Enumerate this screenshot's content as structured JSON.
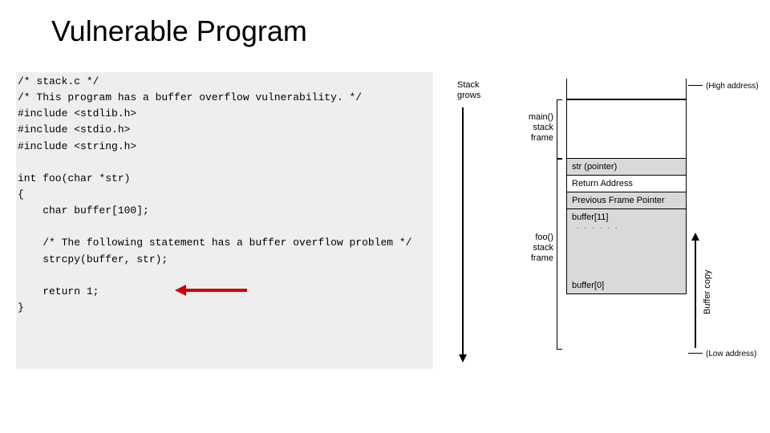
{
  "title": "Vulnerable Program",
  "code": {
    "l1": "/* stack.c */",
    "l2": "/* This program has a buffer overflow vulnerability. */",
    "l3": "#include <stdlib.h>",
    "l4": "#include <stdio.h>",
    "l5": "#include <string.h>",
    "l6": "",
    "l7": "int foo(char *str)",
    "l8": "{",
    "l9": "    char buffer[100];",
    "l10": "",
    "l11": "    /* The following statement has a buffer overflow problem */",
    "l12": "    strcpy(buffer, str);",
    "l13": "",
    "l14": "    return 1;",
    "l15": "}"
  },
  "diagram": {
    "stack_grows": "Stack\ngrows",
    "main_frame": "main()\nstack\nframe",
    "foo_frame": "foo()\nstack\nframe",
    "rows": {
      "str": "str (pointer)",
      "ret": "Return Address",
      "pfp": "Previous Frame Pointer",
      "buf11": "buffer[11]",
      "buf0": "buffer[0]"
    },
    "high_addr": "(High address)",
    "low_addr": "(Low address)",
    "buffer_copy": "Buffer copy"
  }
}
